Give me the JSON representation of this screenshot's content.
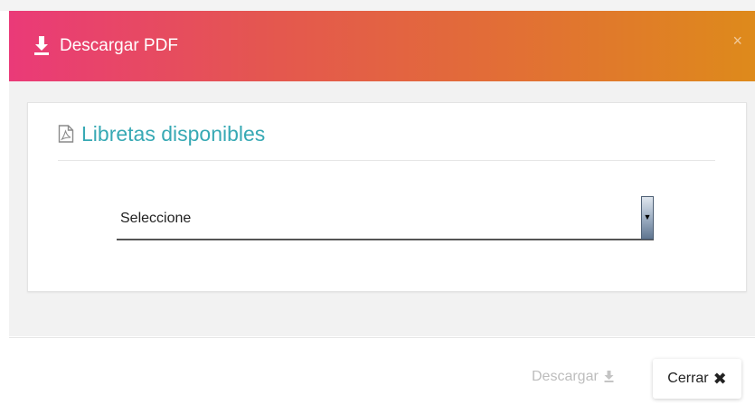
{
  "modal": {
    "title": "Descargar PDF",
    "close_symbol": "×",
    "header_gradient": [
      "#ea3a78",
      "#de8a1b"
    ]
  },
  "card": {
    "title": "Libretas disponibles",
    "title_color": "#37a9b4",
    "select": {
      "selected": "Seleccione"
    }
  },
  "footer": {
    "download_label": "Descargar",
    "close_label": "Cerrar",
    "close_icon_symbol": "✖"
  },
  "icons": {
    "header": "download-icon",
    "card": "pdf-file-icon",
    "download": "download-icon",
    "close": "close-icon"
  }
}
